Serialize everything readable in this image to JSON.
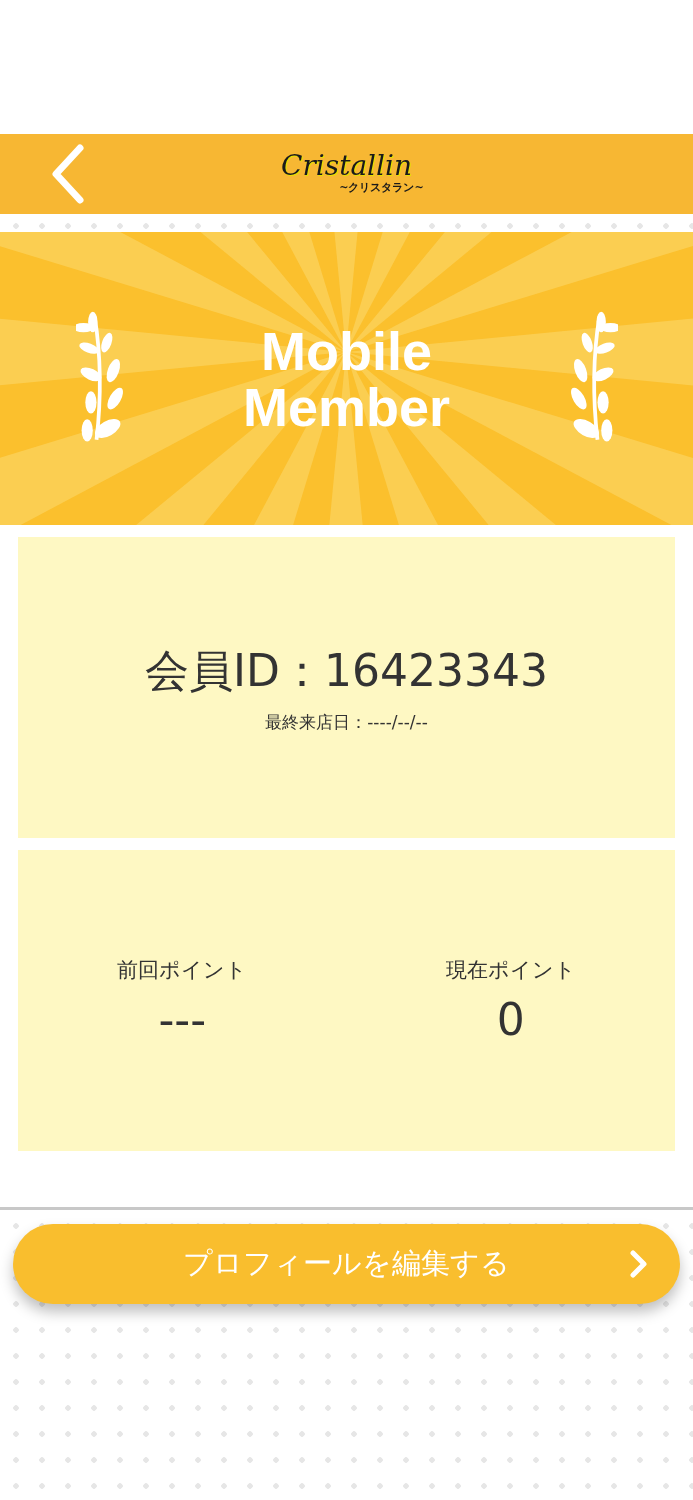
{
  "header": {
    "logo": "Cristallin",
    "logo_sub": "~クリスタラン~"
  },
  "banner": {
    "title_line_1": "Mobile",
    "title_line_2": "Member"
  },
  "member_card": {
    "member_id": "会員ID：16423343",
    "last_visit": "最終来店日：----/--/--"
  },
  "points": [
    {
      "label": "前回ポイント",
      "value": "---"
    },
    {
      "label": "現在ポイント",
      "value": "0"
    }
  ],
  "edit_button": {
    "label": "プロフィールを編集する"
  }
}
